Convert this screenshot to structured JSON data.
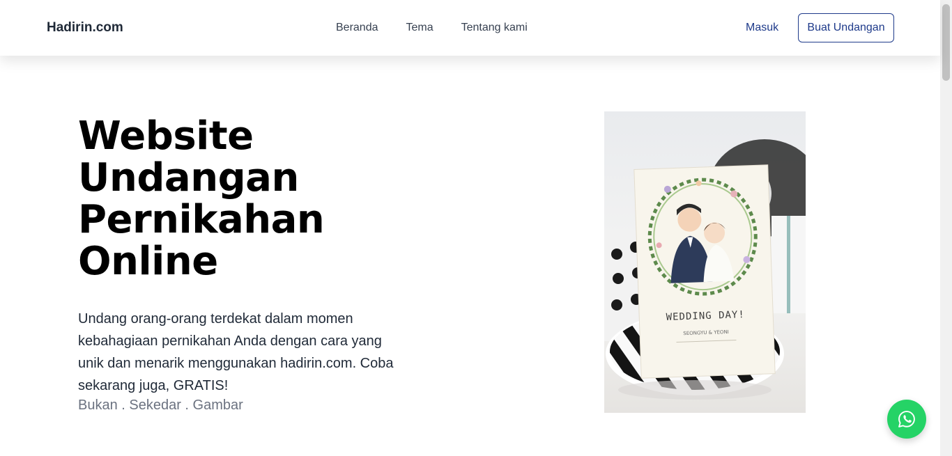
{
  "header": {
    "brand": "Hadirin.com",
    "nav": [
      "Beranda",
      "Tema",
      "Tentang kami"
    ],
    "login_label": "Masuk",
    "cta_label": "Buat Undangan"
  },
  "hero": {
    "title_lines": [
      "Website",
      "Undangan",
      "Pernikahan",
      "Online"
    ],
    "description": "Undang orang-orang terdekat dalam momen kebahagiaan pernikahan Anda dengan cara yang unik dan menarik menggunakan hadirin.com. Coba sekarang juga, GRATIS!",
    "tagline": "Bukan . Sekedar . Gambar",
    "image": {
      "card_title": "WEDDING DAY!",
      "card_names": "SEONGYU & YEONI"
    }
  },
  "icons": {
    "whatsapp": "whatsapp-icon"
  },
  "colors": {
    "accent": "#1e3a8a",
    "whatsapp": "#25d366"
  }
}
